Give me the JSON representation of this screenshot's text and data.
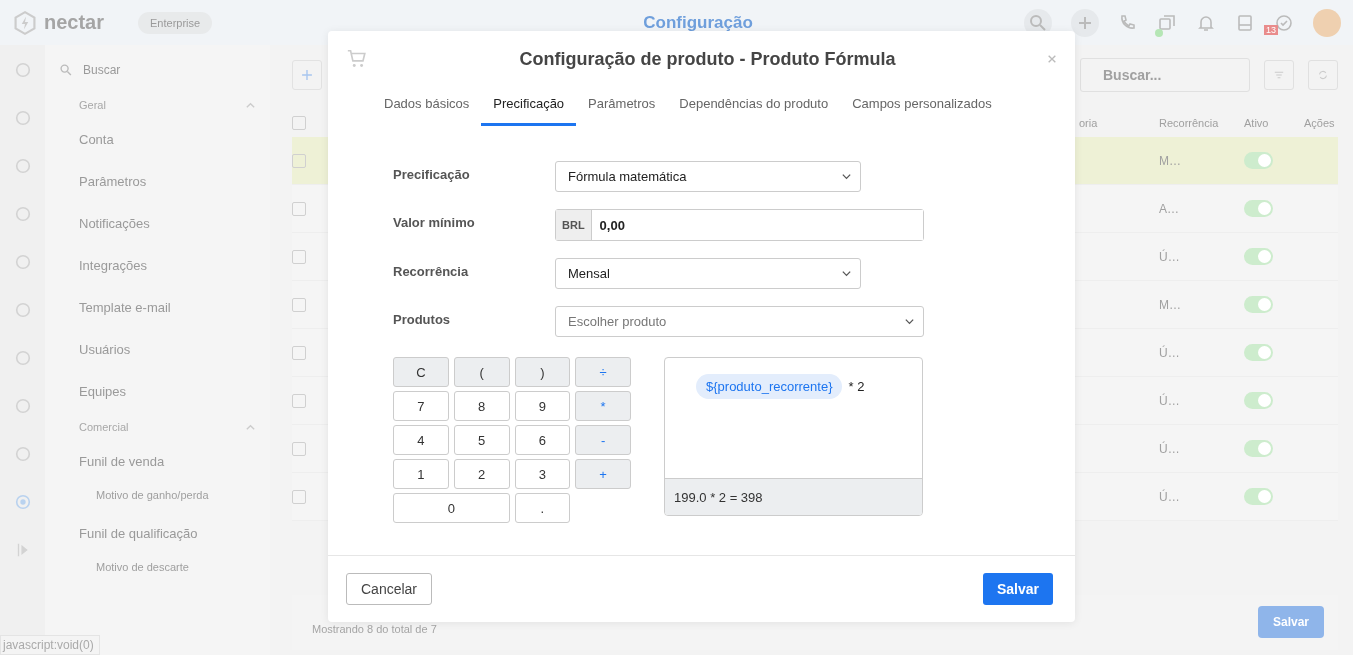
{
  "app": {
    "logo": "nectar",
    "plan_badge": "Enterprise",
    "title": "Configuração",
    "notification_count": "13",
    "status_url": "javascript:void(0)"
  },
  "rail": [
    {
      "selected": false
    },
    {
      "selected": false
    },
    {
      "selected": false
    },
    {
      "selected": false
    },
    {
      "selected": false
    },
    {
      "selected": false
    },
    {
      "selected": false
    },
    {
      "selected": false
    },
    {
      "selected": false
    },
    {
      "selected": true
    }
  ],
  "sidebar": {
    "search_placeholder": "Buscar",
    "sections": [
      {
        "label": "Geral",
        "expanded": true,
        "children": [
          {
            "label": "Conta"
          },
          {
            "label": "Parâmetros"
          },
          {
            "label": "Notificações"
          },
          {
            "label": "Integrações"
          },
          {
            "label": "Template e-mail"
          },
          {
            "label": "Usuários"
          },
          {
            "label": "Equipes"
          }
        ]
      },
      {
        "label": "Comercial",
        "expanded": true,
        "children": [
          {
            "label": "Funil de venda",
            "children": [
              {
                "label": "Motivo de ganho/perda"
              }
            ]
          },
          {
            "label": "Funil de qualificação",
            "children": [
              {
                "label": "Motivo de descarte"
              }
            ]
          }
        ]
      }
    ]
  },
  "table": {
    "search_placeholder": "Buscar...",
    "all_checked": false,
    "columns": [
      "oria",
      "Recorrência",
      "Ativo",
      "Ações"
    ],
    "rows": [
      {
        "recurrence": "M…",
        "active": true,
        "highlighted": true,
        "checked": false
      },
      {
        "recurrence": "A…",
        "active": true,
        "highlighted": false,
        "checked": false
      },
      {
        "recurrence": "Ú…",
        "active": true,
        "highlighted": false,
        "checked": false
      },
      {
        "recurrence": "M…",
        "active": true,
        "highlighted": false,
        "checked": false
      },
      {
        "recurrence": "Ú…",
        "active": true,
        "highlighted": false,
        "checked": false
      },
      {
        "recurrence": "Ú…",
        "active": true,
        "highlighted": false,
        "checked": false
      },
      {
        "recurrence": "Ú…",
        "active": true,
        "highlighted": false,
        "checked": false
      },
      {
        "recurrence": "Ú…",
        "active": true,
        "highlighted": false,
        "checked": false
      }
    ],
    "footer": "Mostrando 8 do total de 7",
    "save_label": "Salvar"
  },
  "modal": {
    "title": "Configuração de produto - Produto Fórmula",
    "tabs": [
      {
        "label": "Dados básicos",
        "selected": false
      },
      {
        "label": "Precificação",
        "selected": true
      },
      {
        "label": "Parâmetros",
        "selected": false
      },
      {
        "label": "Dependências do produto",
        "selected": false
      },
      {
        "label": "Campos personalizados",
        "selected": false
      }
    ],
    "fields": [
      {
        "label": "Precificação",
        "kind": "select",
        "value": "Fórmula matemática",
        "wide": false
      },
      {
        "label": "Valor mínimo",
        "kind": "currency",
        "prefix": "BRL",
        "value": "0,00",
        "wide": true
      },
      {
        "label": "Recorrência",
        "kind": "select",
        "value": "Mensal",
        "wide": false
      },
      {
        "label": "Produtos",
        "kind": "select",
        "placeholder": "Escolher produto",
        "wide": true
      }
    ],
    "keys": [
      {
        "label": "C",
        "kind": "fn",
        "wide": false
      },
      {
        "label": "(",
        "kind": "fn",
        "wide": false
      },
      {
        "label": ")",
        "kind": "fn",
        "wide": false
      },
      {
        "label": "÷",
        "kind": "op",
        "wide": false
      },
      {
        "label": "7",
        "kind": "digit",
        "wide": false
      },
      {
        "label": "8",
        "kind": "digit",
        "wide": false
      },
      {
        "label": "9",
        "kind": "digit",
        "wide": false
      },
      {
        "label": "*",
        "kind": "op",
        "wide": false
      },
      {
        "label": "4",
        "kind": "digit",
        "wide": false
      },
      {
        "label": "5",
        "kind": "digit",
        "wide": false
      },
      {
        "label": "6",
        "kind": "digit",
        "wide": false
      },
      {
        "label": "-",
        "kind": "op",
        "wide": false
      },
      {
        "label": "1",
        "kind": "digit",
        "wide": false
      },
      {
        "label": "2",
        "kind": "digit",
        "wide": false
      },
      {
        "label": "3",
        "kind": "digit",
        "wide": false
      },
      {
        "label": "+",
        "kind": "op",
        "wide": false
      },
      {
        "label": "0",
        "kind": "digit",
        "wide": true
      },
      {
        "label": ".",
        "kind": "digit",
        "wide": false
      }
    ],
    "formula": [
      {
        "kind": "variable",
        "text": "${produto_recorrente}"
      },
      {
        "kind": "text",
        "text": "* 2"
      }
    ],
    "result": "199.0 * 2 = 398",
    "cancel_label": "Cancelar",
    "save_label": "Salvar"
  }
}
